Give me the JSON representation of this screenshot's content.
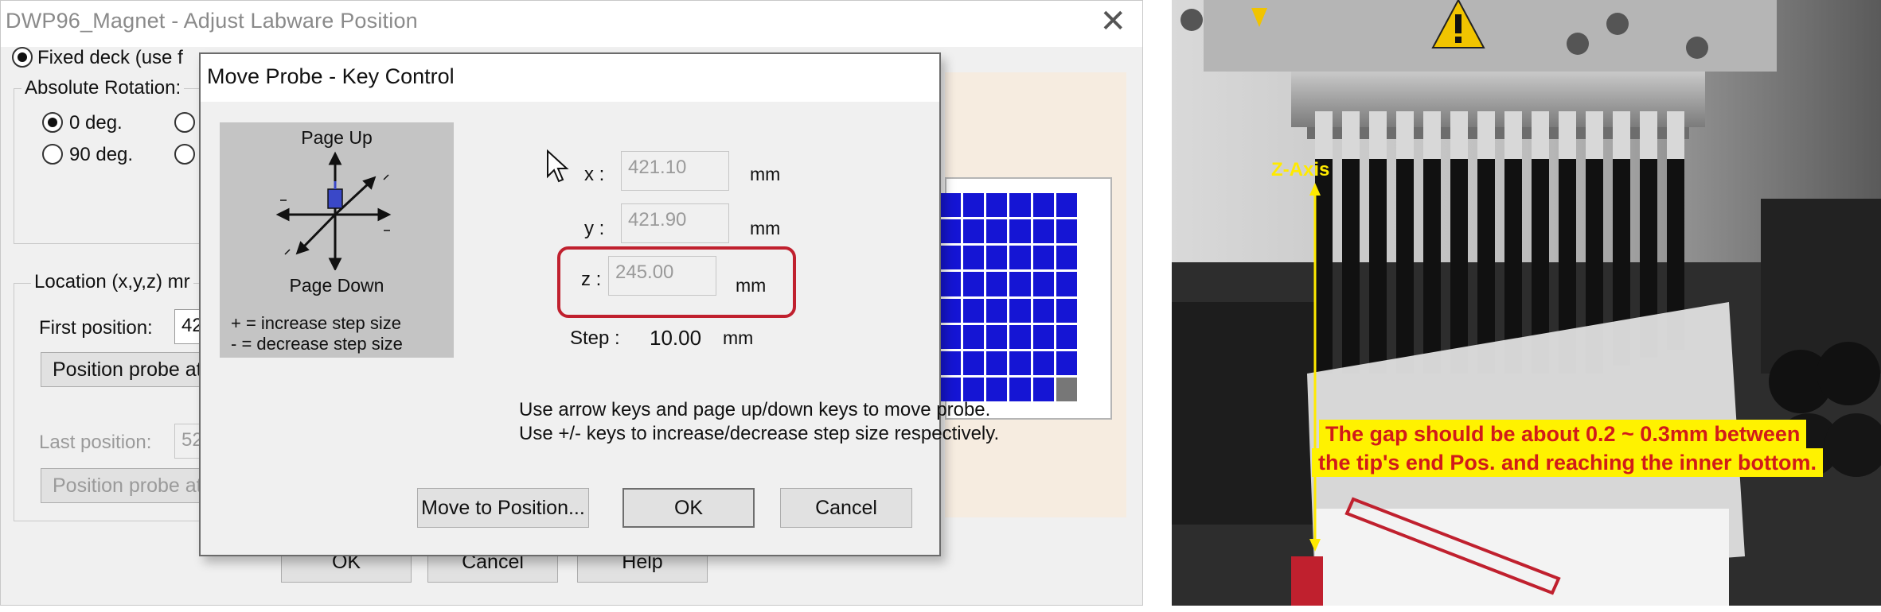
{
  "background_window": {
    "title": "DWP96_Magnet - Adjust Labware Position",
    "close_glyph": "✕",
    "fixed_deck_label": "Fixed deck (use f",
    "absolute_rotation_label": "Absolute Rotation:",
    "rotation_options": [
      "0 deg.",
      "90 deg."
    ],
    "location_group_label": "Location (x,y,z) mr",
    "first_position_label": "First position:",
    "first_position_value": "42",
    "position_probe_first": "Position probe at",
    "last_position_label": "Last position:",
    "last_position_value": "52",
    "position_probe_last": "Position probe at",
    "ok_label": "OK",
    "cancel_label": "Cancel",
    "help_label": "Help"
  },
  "move_probe_dialog": {
    "title": "Move Probe - Key Control",
    "key_panel": {
      "page_up": "Page Up",
      "page_down": "Page Down",
      "increase_hint": "+ = increase step size",
      "decrease_hint": "- = decrease step size"
    },
    "x_label": "x :",
    "x_value": "421.10",
    "y_label": "y :",
    "y_value": "421.90",
    "z_label": "z :",
    "z_value": "245.00",
    "unit": "mm",
    "step_label": "Step :",
    "step_value": "10.00",
    "step_unit": "mm",
    "message_line1": "Use arrow keys and page up/down keys to move probe.",
    "message_line2": "Use +/- keys to increase/decrease step size respectively.",
    "move_to_position_label": "Move to Position...",
    "ok_label": "OK",
    "cancel_label": "Cancel"
  },
  "photo": {
    "z_axis_label": "Z-Axis",
    "annotation_line1": "The gap should be about 0.2 ~ 0.3mm between",
    "annotation_line2": "the tip's end Pos. and reaching the inner bottom."
  },
  "colors": {
    "highlight_red": "#c0202e",
    "well_blue": "#1515d4",
    "annotation_yellow": "#fff200",
    "annotation_text_red": "#d11a1a",
    "axis_yellow": "#ffea00"
  }
}
